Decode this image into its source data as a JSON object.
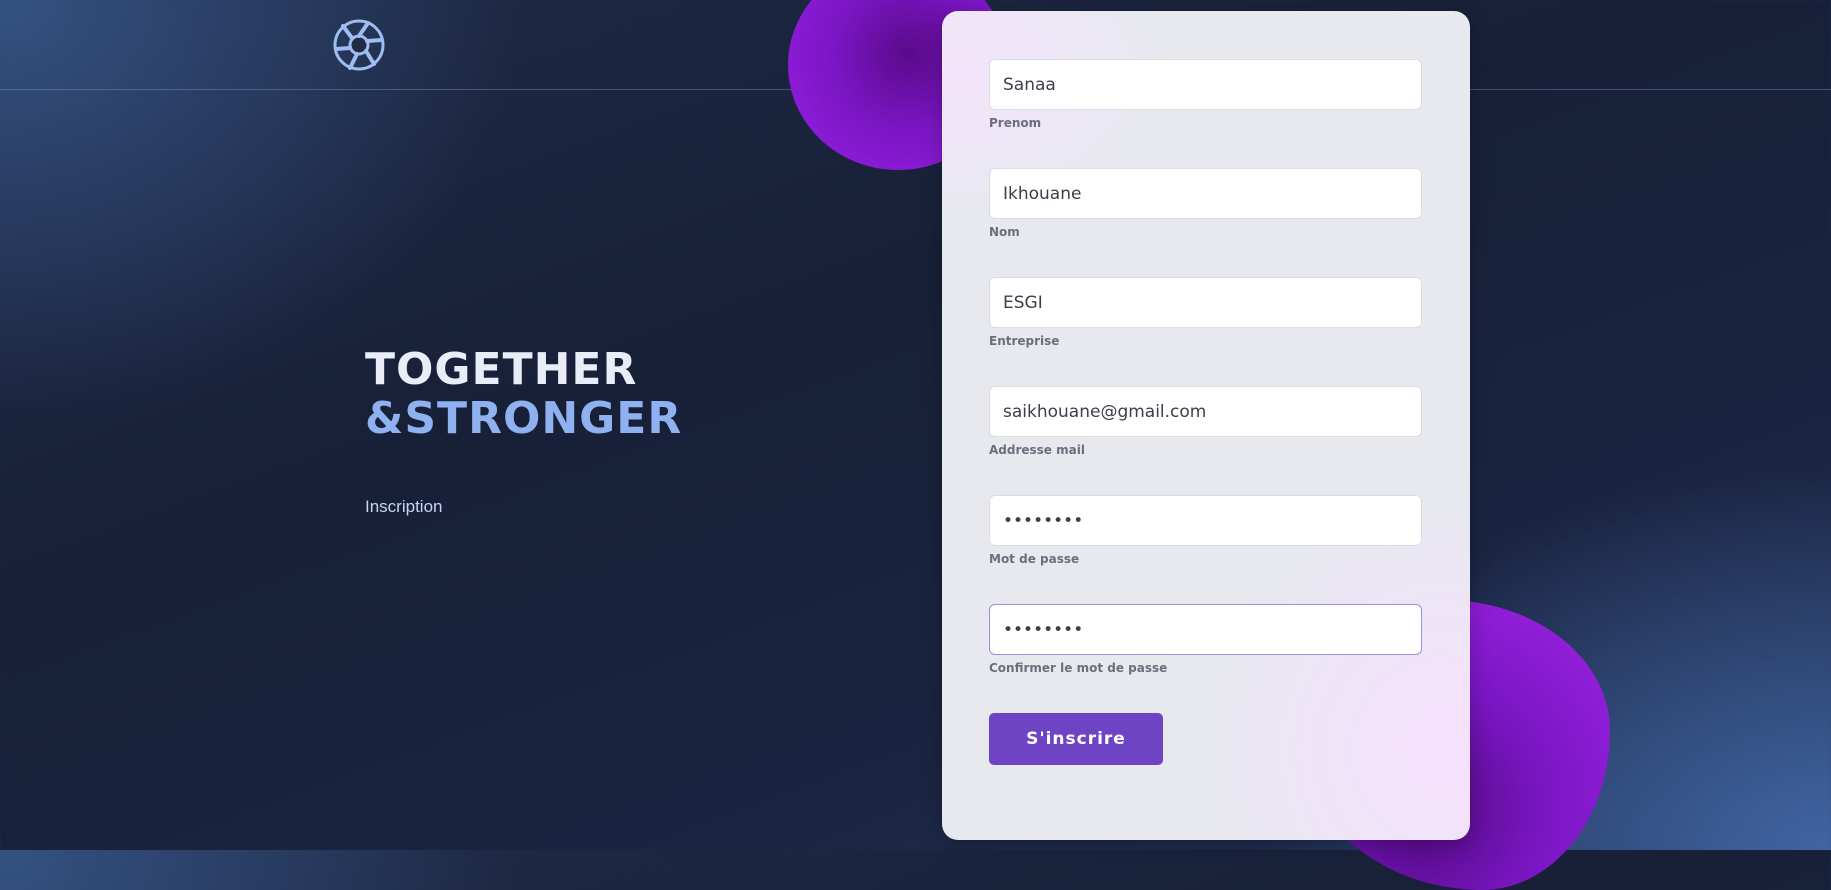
{
  "hero": {
    "line1": "TOGETHER",
    "line2": "&STRONGER"
  },
  "page_subtitle": "Inscription",
  "logo_icon": "aperture-logo-icon",
  "colors": {
    "accent": "#6e44c4",
    "hero_blue": "#8fb1f0",
    "blob": "#8a1ad6"
  },
  "form": {
    "fields": [
      {
        "label": "Prenom",
        "value": "Sanaa",
        "type": "text"
      },
      {
        "label": "Nom",
        "value": "Ikhouane",
        "type": "text"
      },
      {
        "label": "Entreprise",
        "value": "ESGI",
        "type": "text"
      },
      {
        "label": "Addresse mail",
        "value": "saikhouane@gmail.com",
        "type": "email"
      },
      {
        "label": "Mot de passe",
        "value": "••••••••",
        "type": "password"
      },
      {
        "label": "Confirmer le mot de passe",
        "value": "••••••••",
        "type": "password"
      }
    ],
    "submit_label": "S'inscrire"
  }
}
